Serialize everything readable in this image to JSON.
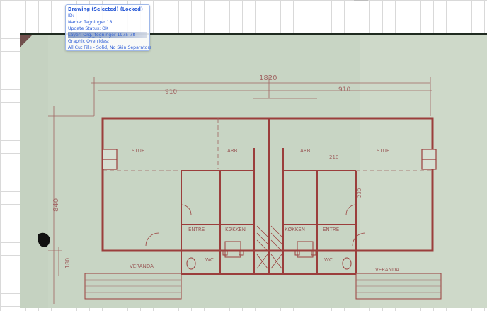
{
  "tooltip": {
    "title": "Drawing (Selected) (Locked)",
    "id_label": "ID:",
    "name": "Name: Tegninger 18",
    "update_status": "Update Status: OK",
    "layer": "Layer: Org._tegninger 1975-78",
    "graphic_overrides": "Graphic Overrides:",
    "fills": "All Cut Fills - Solid, No Skin Separators"
  },
  "plan_labels": {
    "dim_overall": "1820",
    "dim_left": "910",
    "dim_right": "910",
    "dim_height": "840",
    "dim_veranda": "180",
    "dim_small": "210",
    "dim_bath": "230",
    "room_stue_left": "STUE",
    "room_stue_right": "STUE",
    "room_arb_left": "ARB.",
    "room_arb_right": "ARB.",
    "room_entre_left": "ENTRE",
    "room_entre_right": "ENTRE",
    "room_kokken_left": "KØKKEN",
    "room_kokken_right": "KØKKEN",
    "room_veranda_left": "VERANDA",
    "room_veranda_right": "VERANDA",
    "room_wc_left": "WC",
    "room_wc_right": "WC"
  },
  "colors": {
    "paper": "#cbd7c7",
    "ink": "#9a5a58",
    "wall": "#9b3e3c",
    "tooltip_text": "#2a5bd7"
  }
}
